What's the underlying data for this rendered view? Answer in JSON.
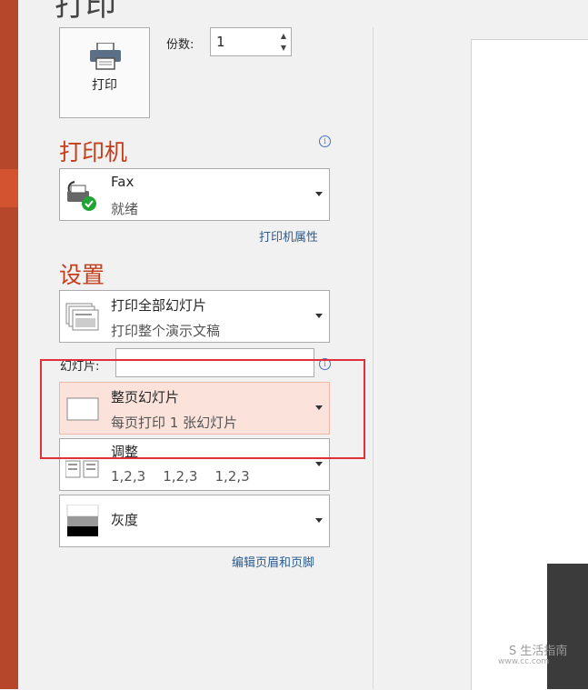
{
  "page": {
    "heading": "打印"
  },
  "print": {
    "button_label": "打印",
    "copies_label": "份数:",
    "copies_value": "1"
  },
  "printer": {
    "section_title": "打印机",
    "name": "Fax",
    "status": "就绪",
    "properties_link": "打印机属性"
  },
  "settings": {
    "section_title": "设置",
    "range": {
      "title": "打印全部幻灯片",
      "subtitle": "打印整个演示文稿"
    },
    "slides_label": "幻灯片:",
    "slides_value": "",
    "layout": {
      "title": "整页幻灯片",
      "subtitle": "每页打印 1 张幻灯片"
    },
    "collate": {
      "title": "调整",
      "subtitle": "1,2,3    1,2,3    1,2,3"
    },
    "color": {
      "title": "灰度"
    },
    "header_footer_link": "编辑页眉和页脚"
  },
  "watermark": {
    "text": "S 生活指南",
    "sub": "www.cc.com"
  },
  "colors": {
    "accent": "#c43e1c",
    "sidebar": "#b7472a",
    "highlight": "#fbe3dc",
    "annotation": "#e0303a"
  }
}
